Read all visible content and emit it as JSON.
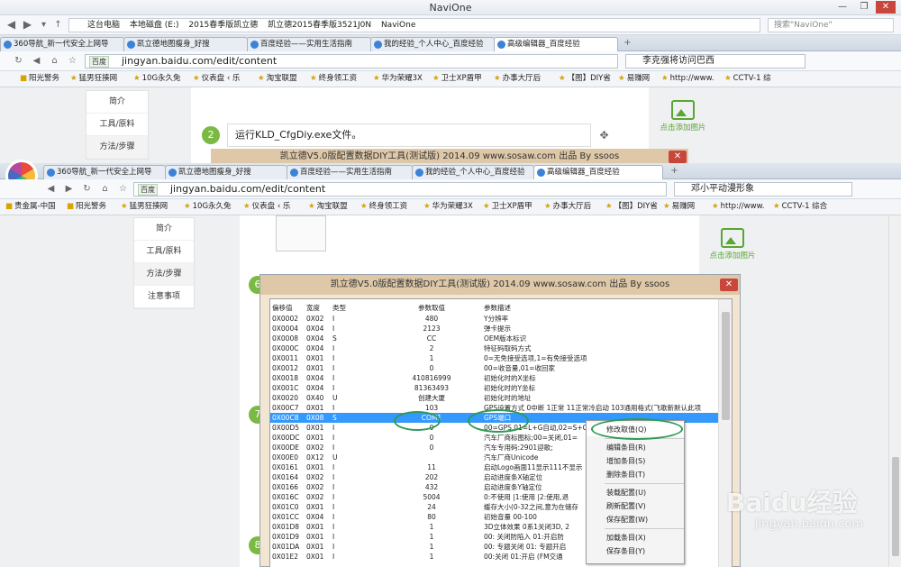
{
  "window": {
    "title": "NaviOne",
    "buttons": [
      "—",
      "❐",
      "✕"
    ]
  },
  "explorer": {
    "crumbs": [
      "这台电脑",
      "本地磁盘 (E:)",
      "2015春季版凯立德",
      "凯立德2015春季版3521J0N",
      "NaviOne"
    ],
    "search_placeholder": "搜索\"NaviOne\""
  },
  "browser1": {
    "tabs": [
      "360导航_新一代安全上网导",
      "凯立德地图瘦身_好搜",
      "百度经验——实用生活指南",
      "我的经验_个人中心_百度经验",
      "高级编辑器_百度经验"
    ],
    "url": "jingyan.baidu.com/edit/content",
    "url_badge": "百度",
    "search": "李克强将访问巴西",
    "favorites": [
      "阳光警务",
      "猛男狂揍网",
      "10G永久免",
      "仪表盘 ‹ 乐",
      "淘宝联盟",
      "终身领工资",
      "华为荣耀3X",
      "卫士XP盾甲",
      "办事大厅后",
      "【图】DIY省",
      "易赚网",
      "http://www.",
      "CCTV-1 综"
    ]
  },
  "page1": {
    "menu": [
      "简介",
      "工具/原料",
      "方法/步骤"
    ],
    "step_num": "2",
    "step_text": "运行KLD_CfgDiy.exe文件。",
    "add_image": "点击添加图片"
  },
  "browser2": {
    "tabs": [
      "360导航_新一代安全上网导",
      "凯立德地图瘦身_好搜",
      "百度经验——实用生活指南",
      "我的经验_个人中心_百度经验",
      "高级编辑器_百度经验"
    ],
    "url": "jingyan.baidu.com/edit/content",
    "url_badge": "百度",
    "search": "邓小平动漫形象",
    "favorites": [
      "贵金属-中国",
      "阳光警务",
      "猛男狂揍网",
      "10G永久免",
      "仪表盘 ‹ 乐",
      "淘宝联盟",
      "终身领工资",
      "华为荣耀3X",
      "卫士XP盾甲",
      "办事大厅后",
      "【图】DIY省",
      "易赚网",
      "http://www.",
      "CCTV-1 综合"
    ]
  },
  "page2": {
    "menu": [
      "简介",
      "工具/原料",
      "方法/步骤",
      "注意事项"
    ],
    "add_image": "点击添加图片",
    "step_nums": [
      "6",
      "7",
      "8"
    ]
  },
  "dialog_behind": {
    "title": "凯立德V5.0版配置数据DIY工具(测试版) 2014.09  www.sosaw.com 出品 By ssoos",
    "close": "✕"
  },
  "dialog": {
    "title": "凯立德V5.0版配置数据DIY工具(测试版) 2014.09  www.sosaw.com 出品 By ssoos",
    "close": "✕",
    "columns": [
      "偏移值",
      "宽度",
      "类型",
      "参数取值",
      "参数描述"
    ],
    "rows": [
      [
        "0X0002",
        "0X02",
        "I",
        "480",
        "Y分辨率"
      ],
      [
        "0X0004",
        "0X04",
        "I",
        "2123",
        "弹卡提示"
      ],
      [
        "0X0008",
        "0X04",
        "S",
        "CC",
        "OEM版本标识"
      ],
      [
        "0X000C",
        "0X04",
        "I",
        "2",
        "特征码取码方式"
      ],
      [
        "0X0011",
        "0X01",
        "I",
        "1",
        "0=无免接受选项,1=有免接受选项"
      ],
      [
        "0X0012",
        "0X01",
        "I",
        "0",
        "00=收音量,01=收回家"
      ],
      [
        "0X0018",
        "0X04",
        "I",
        "410816999",
        "初始化时的X坐标"
      ],
      [
        "0X001C",
        "0X04",
        "I",
        "81363493",
        "初始化时的Y坐标"
      ],
      [
        "0X0020",
        "0X40",
        "U",
        "创建大厦",
        "初始化时的地址"
      ],
      [
        "0X00C7",
        "0X01",
        "I",
        "103",
        "GPS设置方式 0中断 1正常 11正常冷启动 103通用格式(飞歌新默认此项"
      ],
      [
        "0X00C8",
        "0X08",
        "S",
        "COM1",
        "GPS端口"
      ],
      [
        "0X00D5",
        "0X01",
        "I",
        "0",
        "00=GPS,01=L+G自动,02=S+G手动"
      ],
      [
        "0X00DC",
        "0X01",
        "I",
        "0",
        "汽车厂商标图标;00=关闭,01="
      ],
      [
        "0X00DE",
        "0X02",
        "I",
        "0",
        "汽车专用码:2901迎歌;"
      ],
      [
        "0X00E0",
        "0X12",
        "U",
        "",
        "汽车厂商Unicode"
      ],
      [
        "0X0161",
        "0X01",
        "I",
        "11",
        "启动Logo画面11显示111不显示"
      ],
      [
        "0X0164",
        "0X02",
        "I",
        "202",
        "启动进度条X轴定位"
      ],
      [
        "0X0166",
        "0X02",
        "I",
        "432",
        "启动进度条Y轴定位"
      ],
      [
        "0X016C",
        "0X02",
        "I",
        "5004",
        "0:不使用 |1:使用 |2:使用,退"
      ],
      [
        "0X01C0",
        "0X01",
        "I",
        "24",
        "缓存大小(0-32之间,意为在储存"
      ],
      [
        "0X01CC",
        "0X04",
        "I",
        "80",
        "初始音量 00-100"
      ],
      [
        "0X01D8",
        "0X01",
        "I",
        "1",
        "3D立体效果 0系1关闭3D, 2"
      ],
      [
        "0X01D9",
        "0X01",
        "I",
        "1",
        "00: 关闭防陷入  01:开启防"
      ],
      [
        "0X01DA",
        "0X01",
        "I",
        "1",
        "00: 专题关闭  01: 专题开启"
      ],
      [
        "0X01E2",
        "0X01",
        "I",
        "1",
        "00:关闭  01:开启 (FM交通"
      ]
    ],
    "selected_row": 10,
    "row_extra": {
      "12": "...",
      "13": "2.",
      "21": "3D:6"
    }
  },
  "context_menu": [
    "修改取值(Q)",
    "编辑条目(R)",
    "增加条目(S)",
    "删除条目(T)",
    "装载配置(U)",
    "刷新配置(V)",
    "保存配置(W)",
    "加载条目(X)",
    "保存条目(Y)"
  ],
  "watermark": {
    "brand": "Baidu经验",
    "url": "jingyan.baidu.com"
  },
  "colors": {
    "accent_green": "#7ab943",
    "oval_green": "#2e9a54",
    "selection": "#3399ff",
    "dialog_title": "#dec8a8"
  }
}
